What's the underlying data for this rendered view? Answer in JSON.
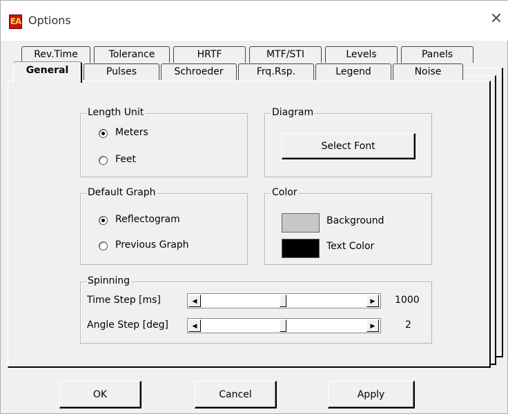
{
  "window": {
    "title": "Options",
    "app_icon_text": "EA",
    "close_glyph": "✕",
    "accent_color": "#c8140e"
  },
  "tabs": {
    "back_row": [
      {
        "label": "Rev.Time"
      },
      {
        "label": "Tolerance"
      },
      {
        "label": "HRTF"
      },
      {
        "label": "MTF/STI"
      },
      {
        "label": "Levels"
      },
      {
        "label": "Panels"
      }
    ],
    "front_row": [
      {
        "label": "General",
        "active": true
      },
      {
        "label": "Pulses"
      },
      {
        "label": "Schroeder"
      },
      {
        "label": "Frq.Rsp."
      },
      {
        "label": "Legend"
      },
      {
        "label": "Noise"
      }
    ]
  },
  "general": {
    "length_unit": {
      "title": "Length Unit",
      "options": [
        "Meters",
        "Feet"
      ],
      "selected": "Meters"
    },
    "diagram": {
      "title": "Diagram",
      "button": "Select Font"
    },
    "default_graph": {
      "title": "Default Graph",
      "options": [
        "Reflectogram",
        "Previous Graph"
      ],
      "selected": "Reflectogram"
    },
    "color": {
      "title": "Color",
      "background_label": "Background",
      "background_swatch": "#c8c8c8",
      "text_label": "Text Color",
      "text_swatch": "#000000"
    },
    "spinning": {
      "title": "Spinning",
      "time_step_label": "Time Step [ms]",
      "time_step_value": "1000",
      "angle_step_label": "Angle Step [deg]",
      "angle_step_value": "2"
    }
  },
  "footer": {
    "ok": "OK",
    "cancel": "Cancel",
    "apply": "Apply"
  }
}
